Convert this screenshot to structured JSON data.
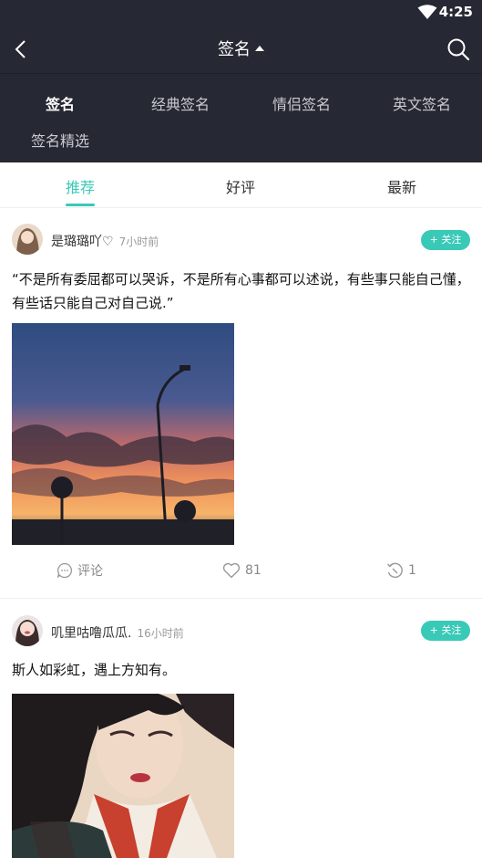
{
  "status_bar": {
    "time": "4:25"
  },
  "header": {
    "title": "签名"
  },
  "categories": [
    "签名",
    "经典签名",
    "情侣签名",
    "英文签名",
    "签名精选"
  ],
  "tabs": [
    "推荐",
    "好评",
    "最新"
  ],
  "posts": [
    {
      "username": "是璐璐吖♡",
      "time": "7小时前",
      "follow_label": "+ 关注",
      "text": "“不是所有委屈都可以哭诉，不是所有心事都可以述说，有些事只能自己懂，有些话只能自己对自己说.”",
      "comment_label": "评论",
      "likes": "81",
      "shares": "1"
    },
    {
      "username": "叽里咕噜瓜瓜.",
      "time": "16小时前",
      "follow_label": "+ 关注",
      "text": "斯人如彩虹，遇上方知有。"
    }
  ],
  "colors": {
    "accent": "#39c9b7",
    "header_bg": "#262833"
  }
}
